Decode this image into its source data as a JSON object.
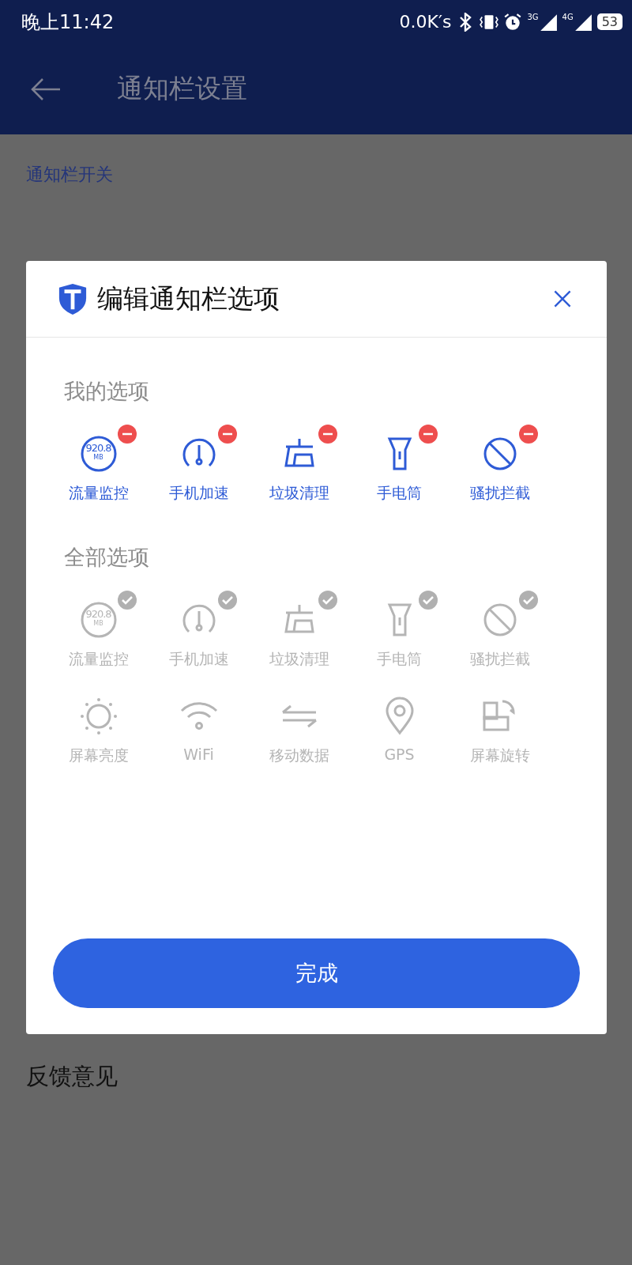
{
  "status_bar": {
    "time": "晚上11:42",
    "speed": "0.0K′s",
    "network_1": "3G",
    "network_2": "4G",
    "battery": "53"
  },
  "header": {
    "title": "通知栏设置"
  },
  "section": {
    "title": "通知栏开关"
  },
  "feedback": {
    "label": "反馈意见"
  },
  "dialog": {
    "title": "编辑通知栏选项",
    "my_options": {
      "title": "我的选项",
      "items": [
        {
          "kind": "traffic",
          "reading": "920.8",
          "unit": "MB",
          "label": "流量监控"
        },
        {
          "kind": "speed",
          "label": "手机加速"
        },
        {
          "kind": "broom",
          "label": "垃圾清理"
        },
        {
          "kind": "flashlight",
          "label": "手电筒"
        },
        {
          "kind": "block",
          "label": "骚扰拦截"
        }
      ]
    },
    "all_options": {
      "title": "全部选项",
      "items": [
        {
          "kind": "traffic",
          "reading": "920.8",
          "unit": "MB",
          "label": "流量监控",
          "added": true
        },
        {
          "kind": "speed",
          "label": "手机加速",
          "added": true
        },
        {
          "kind": "broom",
          "label": "垃圾清理",
          "added": true
        },
        {
          "kind": "flashlight",
          "label": "手电筒",
          "added": true
        },
        {
          "kind": "block",
          "label": "骚扰拦截",
          "added": true
        },
        {
          "kind": "sun",
          "label": "屏幕亮度",
          "added": false
        },
        {
          "kind": "wifi",
          "label": "WiFi",
          "added": false
        },
        {
          "kind": "arrows",
          "label": "移动数据",
          "added": false
        },
        {
          "kind": "pin",
          "label": "GPS",
          "added": false
        },
        {
          "kind": "rotate",
          "label": "屏幕旋转",
          "added": false
        }
      ]
    },
    "done_button": "完成"
  }
}
